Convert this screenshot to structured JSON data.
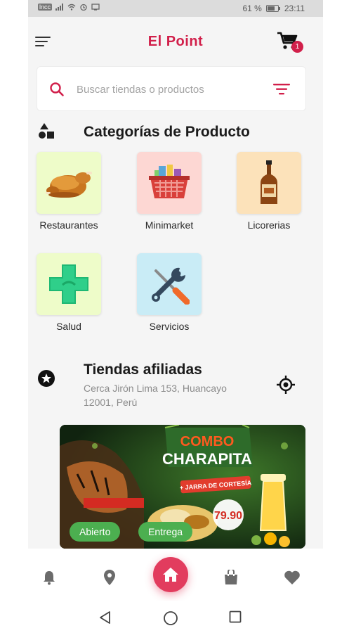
{
  "status_bar": {
    "signal_text": "lncc",
    "battery_percent": "61 %",
    "time": "23:11"
  },
  "header": {
    "title": "El Point",
    "cart_count": "1"
  },
  "search": {
    "placeholder": "Buscar tiendas o productos"
  },
  "categories_section": {
    "title": "Categorías de Producto",
    "items": [
      {
        "label": "Restaurantes",
        "icon": "roast-chicken-icon",
        "bg": "#eefcc9"
      },
      {
        "label": "Minimarket",
        "icon": "shopping-basket-icon",
        "bg": "#fdd7d3"
      },
      {
        "label": "Licorerias",
        "icon": "liquor-bottle-icon",
        "bg": "#fce2ba"
      },
      {
        "label": "Salud",
        "icon": "health-cross-icon",
        "bg": "#eefcc9"
      },
      {
        "label": "Servicios",
        "icon": "tools-icon",
        "bg": "#c9ecf6"
      }
    ]
  },
  "stores_section": {
    "title": "Tiendas afiliadas",
    "address": "Cerca Jirón Lima 153, Huancayo 12001, Perú",
    "store_card": {
      "promo_line1": "COMBO",
      "promo_line2": "CHARAPITA",
      "promo_line3": "+ JARRA DE CORTESÍA",
      "price": "79.90",
      "status_open": "Abierto",
      "status_delivery": "Entrega"
    }
  },
  "bottom_nav": [
    "bell-icon",
    "map-pin-icon",
    "home-icon",
    "shopping-bag-icon",
    "heart-icon"
  ],
  "colors": {
    "brand": "#d11f4a",
    "home_button": "#e23c5e",
    "pill": "#4caf50"
  }
}
